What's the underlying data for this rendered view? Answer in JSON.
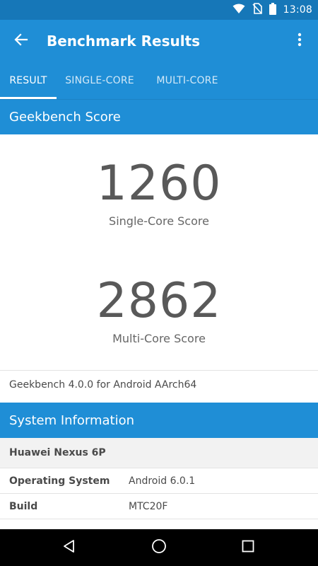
{
  "status_bar": {
    "time": "13:08",
    "icons": [
      "wifi-icon",
      "no-sim-icon",
      "battery-icon"
    ]
  },
  "app_bar": {
    "title": "Benchmark Results",
    "back_icon": "arrow-back-icon",
    "menu_icon": "more-vert-icon"
  },
  "tabs": [
    {
      "label": "RESULT",
      "active": true
    },
    {
      "label": "SINGLE-CORE",
      "active": false
    },
    {
      "label": "MULTI-CORE",
      "active": false
    }
  ],
  "geekbench": {
    "header": "Geekbench Score",
    "single_core_score": "1260",
    "single_core_label": "Single-Core Score",
    "multi_core_score": "2862",
    "multi_core_label": "Multi-Core Score",
    "version": "Geekbench 4.0.0 for Android AArch64"
  },
  "system_info": {
    "header": "System Information",
    "device": "Huawei Nexus 6P",
    "rows": [
      {
        "label": "Operating System",
        "value": "Android 6.0.1"
      },
      {
        "label": "Build",
        "value": "MTC20F"
      }
    ]
  },
  "nav_bar": {
    "icons": [
      "nav-back-icon",
      "nav-home-icon",
      "nav-recents-icon"
    ]
  },
  "colors": {
    "primary": "#1f8ed6",
    "status_bar": "#1677b8",
    "score_text": "#595959"
  }
}
